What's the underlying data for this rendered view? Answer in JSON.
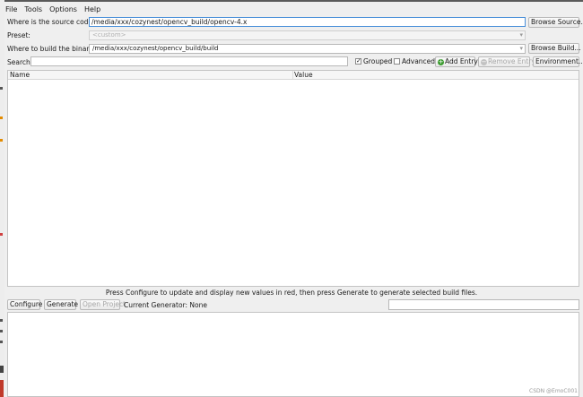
{
  "menu": {
    "file": "File",
    "tools": "Tools",
    "options": "Options",
    "help": "Help"
  },
  "source": {
    "label": "Where is the source code:",
    "value": "/media/xxx/cozynest/opencv_build/opencv-4.x",
    "browse_label": "Browse Source..."
  },
  "preset": {
    "label": "Preset:",
    "value": "<custom>"
  },
  "build": {
    "label": "Where to build the binaries:",
    "value": "/media/xxx/cozynest/opencv_build/build",
    "browse_label": "Browse Build..."
  },
  "search": {
    "label": "Search:",
    "value": ""
  },
  "toolbar": {
    "grouped_label": "Grouped",
    "grouped_checked": true,
    "advanced_label": "Advanced",
    "advanced_checked": false,
    "add_entry_label": "Add Entry",
    "remove_entry_label": "Remove Entry",
    "environment_label": "Environment..."
  },
  "table": {
    "columns": [
      "Name",
      "Value"
    ]
  },
  "hint_text": "Press Configure to update and display new values in red, then press Generate to generate selected build files.",
  "bottom": {
    "configure_label": "Configure",
    "generate_label": "Generate",
    "open_project_label": "Open Project",
    "current_generator": "Current Generator: None"
  },
  "watermark": "CSDN @EmoC001",
  "colors": {
    "accent": "#4a90d9",
    "add_icon": "#3a9a2e",
    "background": "#efefef"
  }
}
